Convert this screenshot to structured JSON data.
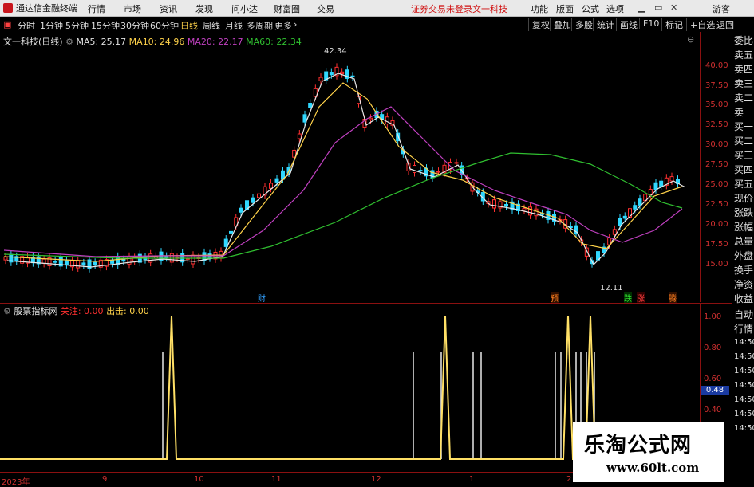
{
  "menubar": {
    "app_name": "通达信金融终端",
    "menus": [
      "行情",
      "市场",
      "资讯",
      "发现",
      "问小达",
      "财富圈",
      "交易"
    ],
    "notice": "证券交易未登录",
    "stock_title": "文一科技",
    "right_menus": [
      "功能",
      "版面",
      "公式",
      "选项"
    ],
    "guest": "游客"
  },
  "toolbar": {
    "periods": [
      "分时",
      "1分钟",
      "5分钟",
      "15分钟",
      "30分钟",
      "60分钟",
      "日线",
      "周线",
      "月线",
      "多周期",
      "更多"
    ],
    "active_period": "日线",
    "right_tools": [
      "复权",
      "叠加",
      "多股",
      "统计",
      "画线",
      "F10",
      "标记",
      "+自选",
      "返回"
    ]
  },
  "main_legend": {
    "title": "文一科技(日线)",
    "ma5": "MA5: 25.17",
    "ma10": "MA10: 24.96",
    "ma20": "MA20: 22.17",
    "ma60": "MA60: 22.34"
  },
  "price_axis": [
    "40.00",
    "37.50",
    "35.00",
    "32.50",
    "30.00",
    "27.50",
    "25.00",
    "22.50",
    "20.00",
    "17.50",
    "15.00"
  ],
  "annotations": {
    "high": "42.34",
    "low": "12.11",
    "cai": "财",
    "yu": "预",
    "die": "跌",
    "zhang": "涨",
    "teng": "腾"
  },
  "indicator_legend": {
    "title": "股票指标网",
    "guanzhu": "关注: 0.00",
    "chuji": "出击: 0.00"
  },
  "indicator_axis": [
    "1.00",
    "0.80",
    "0.60",
    "0.40"
  ],
  "indicator_value_box": "0.48",
  "x_axis": [
    "2023年",
    "9",
    "10",
    "11",
    "12",
    "1",
    "2"
  ],
  "side_panel": [
    "委比",
    "卖五",
    "卖四",
    "卖三",
    "卖二",
    "卖一",
    "买一",
    "买二",
    "买三",
    "买四",
    "买五",
    "现价",
    "涨跌",
    "涨幅",
    "总量",
    "外盘",
    "换手",
    "净资",
    "收益",
    "自动",
    "行情",
    "14:50",
    "14:50",
    "14:50",
    "14:50",
    "14:50",
    "14:50",
    "14:50"
  ],
  "watermark": {
    "title": "乐淘公式网",
    "url": "www.60lt.com"
  },
  "colors": {
    "up": "#ff3030",
    "down": "#30d8ff",
    "ma5": "#e8e8e8",
    "ma10": "#ffd24a",
    "ma20": "#c040c0",
    "ma60": "#30c030",
    "signal": "#ffe066"
  }
}
